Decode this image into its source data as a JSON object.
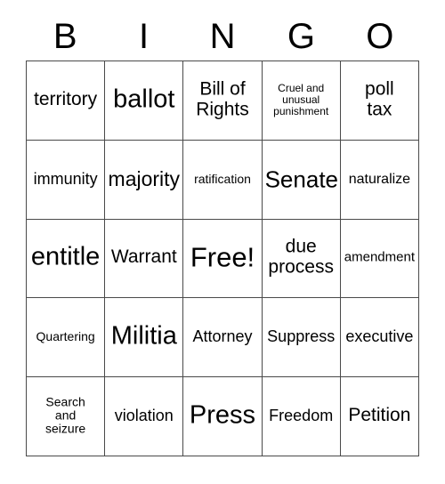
{
  "card": {
    "title_letters": [
      "B",
      "I",
      "N",
      "G",
      "O"
    ],
    "columns": 5,
    "rows": 5,
    "border_color": "#4a4a4a",
    "background_color": "#ffffff",
    "text_color": "#000000",
    "free_space": "Free!"
  },
  "cells": [
    [
      {
        "text": "territory",
        "size": "fs-l"
      },
      {
        "text": "ballot",
        "size": "fs-3xl"
      },
      {
        "text": "Bill of\nRights",
        "size": "fs-l"
      },
      {
        "text": "Cruel and\nunusual\npunishment",
        "size": "fs-xxs"
      },
      {
        "text": "poll\ntax",
        "size": "fs-l"
      }
    ],
    [
      {
        "text": "immunity",
        "size": "fs-m"
      },
      {
        "text": "majority",
        "size": "fs-xl"
      },
      {
        "text": "ratification",
        "size": "fs-xs"
      },
      {
        "text": "Senate",
        "size": "fs-xxl"
      },
      {
        "text": "naturalize",
        "size": "fs-sm"
      }
    ],
    [
      {
        "text": "entitle",
        "size": "fs-3xl"
      },
      {
        "text": "Warrant",
        "size": "fs-l"
      },
      {
        "text": "Free!",
        "size": "fs-4xl"
      },
      {
        "text": "due\nprocess",
        "size": "fs-l"
      },
      {
        "text": "amendment",
        "size": "fs-s"
      }
    ],
    [
      {
        "text": "Quartering",
        "size": "fs-xs"
      },
      {
        "text": "Militia",
        "size": "fs-3xl"
      },
      {
        "text": "Attorney",
        "size": "fs-m"
      },
      {
        "text": "Suppress",
        "size": "fs-m"
      },
      {
        "text": "executive",
        "size": "fs-m"
      }
    ],
    [
      {
        "text": "Search\nand\nseizure",
        "size": "fs-xs"
      },
      {
        "text": "violation",
        "size": "fs-m"
      },
      {
        "text": "Press",
        "size": "fs-3xl"
      },
      {
        "text": "Freedom",
        "size": "fs-m"
      },
      {
        "text": "Petition",
        "size": "fs-l"
      }
    ]
  ]
}
